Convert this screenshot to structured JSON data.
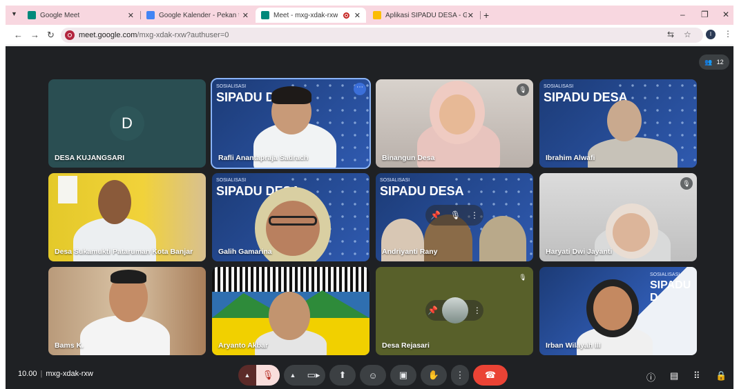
{
  "browser": {
    "tabs": [
      {
        "label": "Google Meet",
        "color": "#00897b"
      },
      {
        "label": "Google Kalender - Pekan tangg",
        "color": "#4285f4"
      },
      {
        "label": "Meet - mxg-xdak-rxw",
        "color": "#00897b"
      },
      {
        "label": "Aplikasi SIPADU DESA - Google",
        "color": "#fbbc04"
      }
    ],
    "url_host": "meet.google.com",
    "url_rest": "/mxg-xdak-rxw?authuser=0",
    "profile_initial": "I"
  },
  "meet": {
    "participant_count": "12",
    "time": "10.00",
    "meeting_code": "mxg-xdak-rxw",
    "participants": [
      {
        "name": "DESA KUJANGSARI",
        "avatar_letter": "D"
      },
      {
        "name": "Rafli Anantapraja Sadrach",
        "slide_title": "SIPADU DESA",
        "slide_kicker": "SOSIALISASI"
      },
      {
        "name": "Binangun Desa"
      },
      {
        "name": "Ibrahim Alwafi",
        "slide_title": "SIPADU DESA",
        "slide_kicker": "SOSIALISASI"
      },
      {
        "name": "Desa Sukamukti Pataruman Kota Banjar"
      },
      {
        "name": "Galih Gamarina",
        "slide_title": "SIPADU DESA",
        "slide_kicker": "SOSIALISASI"
      },
      {
        "name": "Andriyanti Rany",
        "slide_title": "SIPADU DESA",
        "slide_kicker": "SOSIALISASI"
      },
      {
        "name": "Haryati Dwi Jayanti"
      },
      {
        "name": "Bams K."
      },
      {
        "name": "Aryanto Akbar"
      },
      {
        "name": "Desa Rejasari"
      },
      {
        "name": "Irban Wilayah III",
        "slide_title": "SIPADU D",
        "slide_kicker": "SOSIALISASI"
      }
    ]
  }
}
